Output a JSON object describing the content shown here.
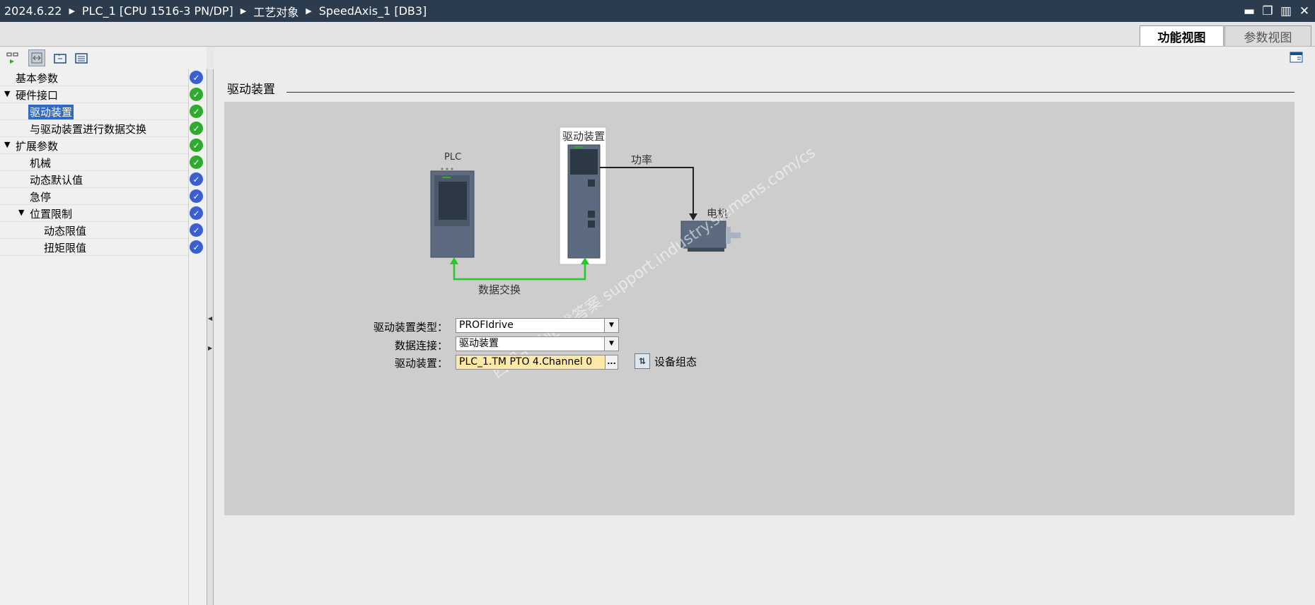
{
  "breadcrumb": [
    "2024.6.22",
    "PLC_1 [CPU 1516-3 PN/DP]",
    "工艺对象",
    "SpeedAxis_1 [DB3]"
  ],
  "window_controls": [
    "minimize-icon",
    "restore-icon",
    "float-icon",
    "close-icon"
  ],
  "tabs": [
    {
      "label": "功能视图",
      "active": true
    },
    {
      "label": "参数视图",
      "active": false
    }
  ],
  "toolbar_icons": [
    "online-compare-icon",
    "toggle-view-icon",
    "expand-folder-icon",
    "collapse-folder-icon"
  ],
  "nav": [
    {
      "label": "基本参数",
      "level": 0,
      "expanded": null,
      "status": "blue"
    },
    {
      "label": "硬件接口",
      "level": 0,
      "expanded": true,
      "status": "green"
    },
    {
      "label": "驱动装置",
      "level": 1,
      "expanded": null,
      "status": "green",
      "selected": true
    },
    {
      "label": "与驱动装置进行数据交换",
      "level": 1,
      "expanded": null,
      "status": "green"
    },
    {
      "label": "扩展参数",
      "level": 0,
      "expanded": true,
      "status": "green"
    },
    {
      "label": "机械",
      "level": 1,
      "expanded": null,
      "status": "green"
    },
    {
      "label": "动态默认值",
      "level": 1,
      "expanded": null,
      "status": "blue"
    },
    {
      "label": "急停",
      "level": 1,
      "expanded": null,
      "status": "blue"
    },
    {
      "label": "位置限制",
      "level": 1,
      "expanded": true,
      "status": "blue"
    },
    {
      "label": "动态限值",
      "level": 2,
      "expanded": null,
      "status": "blue"
    },
    {
      "label": "扭矩限值",
      "level": 2,
      "expanded": null,
      "status": "blue"
    }
  ],
  "section_title": "驱动装置",
  "diagram": {
    "plc_label": "PLC",
    "drive_label": "驱动装置",
    "power_label": "功率",
    "motor_label": "电机",
    "exchange_label": "数据交换"
  },
  "form": {
    "drive_type_label": "驱动装置类型：",
    "drive_type_value": "PROFIdrive",
    "data_conn_label": "数据连接：",
    "data_conn_value": "驱动装置",
    "drive_label": "驱动装置：",
    "drive_value": "PLC_1.TM PTO 4.Channel 0",
    "device_config_label": "设备组态"
  },
  "watermark": "西门子工业 找答案 support.industry.siemens.com/cs",
  "colors": {
    "titlebar": "#2b3c4f",
    "status_green": "#2faa2f",
    "status_blue": "#3a5fd0",
    "selection": "#3169c6",
    "exchange_arrow": "#22cc22"
  }
}
